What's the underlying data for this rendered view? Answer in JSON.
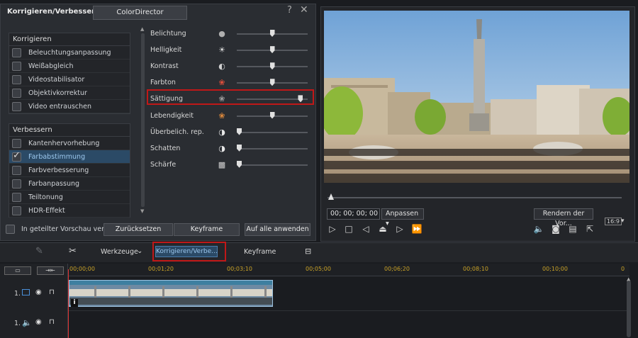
{
  "panel": {
    "title": "Korrigieren/Verbessern",
    "tab": "ColorDirector",
    "help": "?",
    "close": "✕",
    "group1": {
      "header": "Korrigieren",
      "items": [
        "Beleuchtungsanpassung",
        "Weißabgleich",
        "Videostabilisator",
        "Objektivkorrektur",
        "Video entrauschen"
      ]
    },
    "group2": {
      "header": "Verbessern",
      "items": [
        "Kantenhervorhebung",
        "Farbabstimmung",
        "Farbverbesserung",
        "Farbanpassung",
        "Teiltonung",
        "HDR-Effekt"
      ],
      "selected": "Farbabstimmung"
    },
    "params": [
      {
        "label": "Belichtung",
        "icon": "exposure-icon",
        "value": 0.5
      },
      {
        "label": "Helligkeit",
        "icon": "sun-icon",
        "value": 0.5
      },
      {
        "label": "Kontrast",
        "icon": "contrast-icon",
        "value": 0.5
      },
      {
        "label": "Farbton",
        "icon": "rgb-hue-icon",
        "value": 0.5
      },
      {
        "label": "Sättigung",
        "icon": "saturation-icon",
        "value": 0.93
      },
      {
        "label": "Lebendigkeit",
        "icon": "vibrance-icon",
        "value": 0.5
      },
      {
        "label": "Überbelich. rep.",
        "icon": "half-circle-icon",
        "value": 0.0
      },
      {
        "label": "Schatten",
        "icon": "half-circle-icon",
        "value": 0.0
      },
      {
        "label": "Schärfe",
        "icon": "sharpness-icon",
        "value": 0.0
      }
    ],
    "compare_label": "In geteilter Vorschau vergl...",
    "reset_label": "Zurücksetzen",
    "keyframe_label": "Keyframe",
    "apply_all_label": "Auf alle anwenden"
  },
  "preview": {
    "timecode": "00; 00; 00; 00",
    "fit_label": "Anpassen",
    "render_label": "Rendern der Vor...",
    "aspect": "16:9"
  },
  "toolbar": {
    "tools_label": "Werkzeuge",
    "korr_tab": "Korrigieren/Verbe...",
    "keyframe_label": "Keyframe"
  },
  "timeline": {
    "ticks": [
      "00;00;00",
      "00;01;20",
      "00;03;10",
      "00;05;00",
      "00;06;20",
      "00;08;10",
      "00;10;00",
      "0"
    ],
    "tracks": [
      "1.",
      "1."
    ]
  },
  "colors": {
    "accent": "#2b4a66",
    "highlight": "#c01818",
    "tick": "#c9a227"
  }
}
